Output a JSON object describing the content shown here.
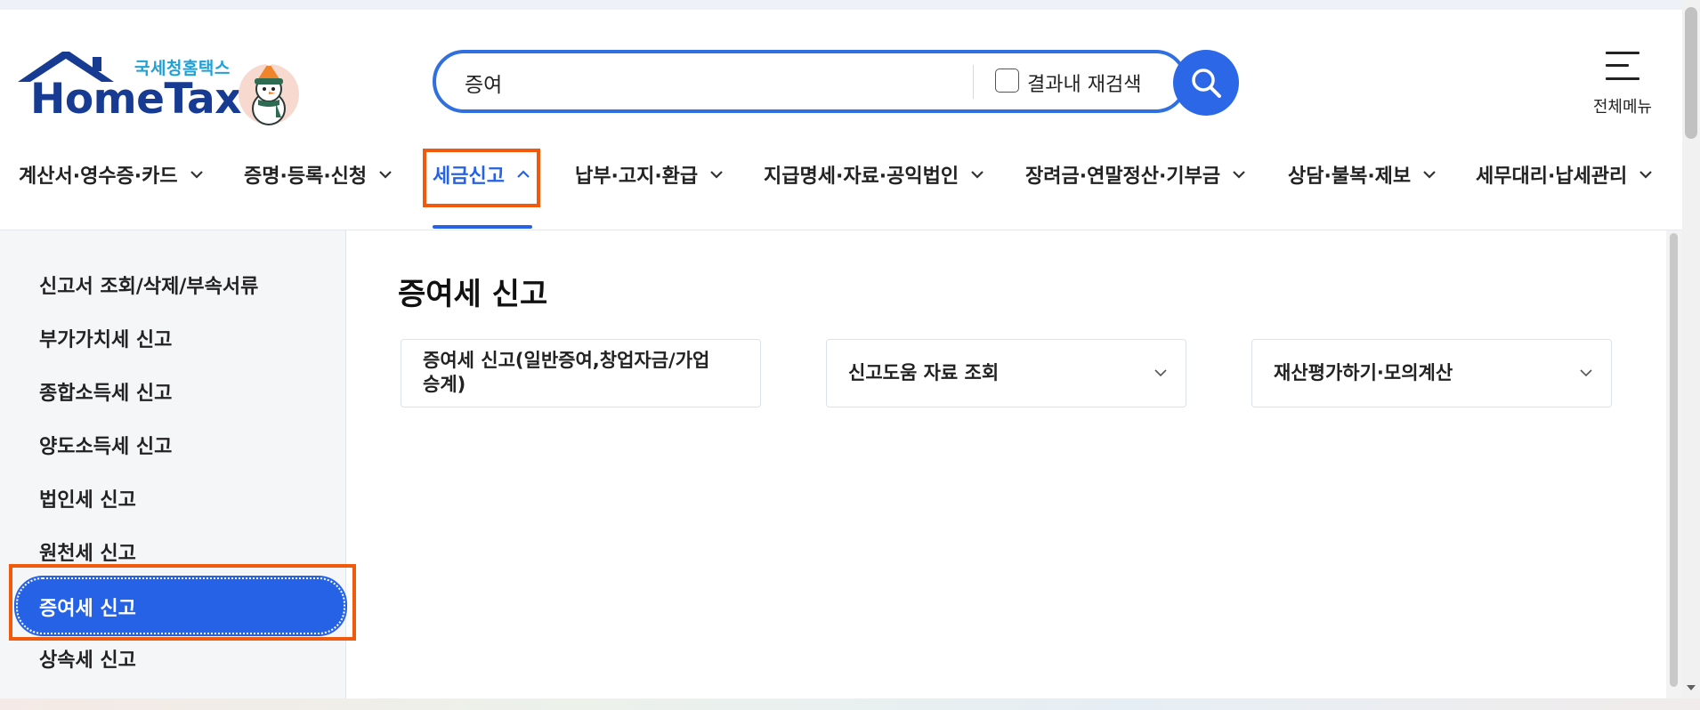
{
  "logo": {
    "subtitle": "국세청홈택스",
    "title": "HomeTax",
    "house_icon": "house-roof-icon",
    "mascot_icon": "snowman-mascot-icon"
  },
  "search": {
    "value": "증여",
    "research_label": "결과내 재검색",
    "research_checked": false,
    "button_icon": "search-icon"
  },
  "all_menu": {
    "label": "전체메뉴",
    "icon": "hamburger-icon"
  },
  "gnb": {
    "items": [
      {
        "label": "계산서·영수증·카드",
        "active": false
      },
      {
        "label": "증명·등록·신청",
        "active": false
      },
      {
        "label": "세금신고",
        "active": true
      },
      {
        "label": "납부·고지·환급",
        "active": false
      },
      {
        "label": "지급명세·자료·공익법인",
        "active": false
      },
      {
        "label": "장려금·연말정산·기부금",
        "active": false
      },
      {
        "label": "상담·불복·제보",
        "active": false
      },
      {
        "label": "세무대리·납세관리",
        "active": false
      }
    ]
  },
  "sidebar": {
    "items": [
      {
        "label": "신고서 조회/삭제/부속서류",
        "active": false
      },
      {
        "label": "부가가치세 신고",
        "active": false
      },
      {
        "label": "종합소득세 신고",
        "active": false
      },
      {
        "label": "양도소득세 신고",
        "active": false
      },
      {
        "label": "법인세 신고",
        "active": false
      },
      {
        "label": "원천세 신고",
        "active": false
      },
      {
        "label": "증여세 신고",
        "active": true
      },
      {
        "label": "상속세 신고",
        "active": false
      }
    ]
  },
  "main": {
    "title": "증여세 신고",
    "cards": [
      {
        "line1": "증여세 신고(일반증여,창업자금/가업",
        "line2": "승계)",
        "has_chevron": false
      },
      {
        "line1": "신고도움 자료 조회",
        "line2": "",
        "has_chevron": true
      },
      {
        "line1": "재산평가하기·모의계산",
        "line2": "",
        "has_chevron": true
      }
    ]
  },
  "colors": {
    "primary": "#2662e5",
    "highlight": "#f15a0c",
    "navy": "#173a93",
    "sky": "#1fa1d8"
  }
}
